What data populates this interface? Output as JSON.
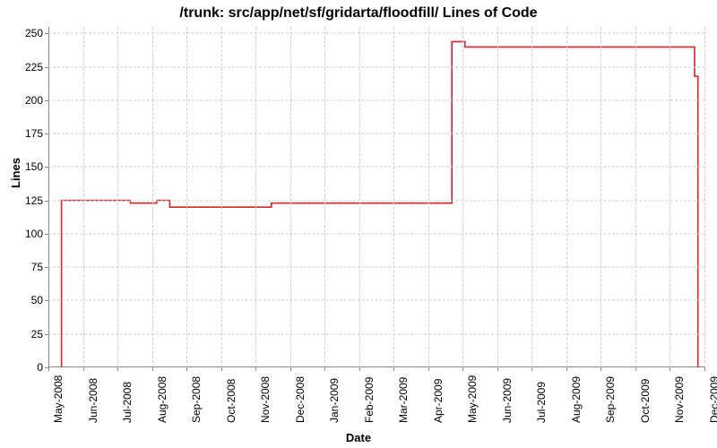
{
  "chart_data": {
    "type": "line",
    "title": "/trunk: src/app/net/sf/gridarta/floodfill/ Lines of Code",
    "xlabel": "Date",
    "ylabel": "Lines",
    "ylim": [
      0,
      255
    ],
    "yticks": [
      0,
      25,
      50,
      75,
      100,
      125,
      150,
      175,
      200,
      225,
      250
    ],
    "xticks": [
      "May-2008",
      "Jun-2008",
      "Jul-2008",
      "Aug-2008",
      "Sep-2008",
      "Oct-2008",
      "Nov-2008",
      "Dec-2008",
      "Jan-2009",
      "Feb-2009",
      "Mar-2009",
      "Apr-2009",
      "May-2009",
      "Jun-2009",
      "Jul-2009",
      "Aug-2009",
      "Sep-2009",
      "Oct-2009",
      "Nov-2009",
      "Dec-2009"
    ],
    "series": [
      {
        "name": "Lines of Code",
        "color": "#d62728",
        "points": [
          {
            "x": "May-2008",
            "xfrac": 0.02,
            "y": 0
          },
          {
            "x": "May-2008",
            "xfrac": 0.02,
            "y": 125
          },
          {
            "x": "Jul-2008",
            "xfrac": 0.125,
            "y": 125
          },
          {
            "x": "Jul-2008",
            "xfrac": 0.125,
            "y": 123
          },
          {
            "x": "Aug-2008",
            "xfrac": 0.165,
            "y": 123
          },
          {
            "x": "Aug-2008",
            "xfrac": 0.165,
            "y": 125
          },
          {
            "x": "Aug-2008",
            "xfrac": 0.185,
            "y": 125
          },
          {
            "x": "Aug-2008",
            "xfrac": 0.185,
            "y": 120
          },
          {
            "x": "Nov-2008",
            "xfrac": 0.34,
            "y": 120
          },
          {
            "x": "Nov-2008",
            "xfrac": 0.34,
            "y": 123
          },
          {
            "x": "Apr-2009",
            "xfrac": 0.615,
            "y": 123
          },
          {
            "x": "Apr-2009",
            "xfrac": 0.615,
            "y": 244
          },
          {
            "x": "May-2009",
            "xfrac": 0.635,
            "y": 244
          },
          {
            "x": "May-2009",
            "xfrac": 0.635,
            "y": 240
          },
          {
            "x": "Dec-2009",
            "xfrac": 0.985,
            "y": 240
          },
          {
            "x": "Dec-2009",
            "xfrac": 0.985,
            "y": 218
          },
          {
            "x": "Dec-2009",
            "xfrac": 0.99,
            "y": 218
          },
          {
            "x": "Dec-2009",
            "xfrac": 0.99,
            "y": 0
          }
        ]
      }
    ]
  }
}
